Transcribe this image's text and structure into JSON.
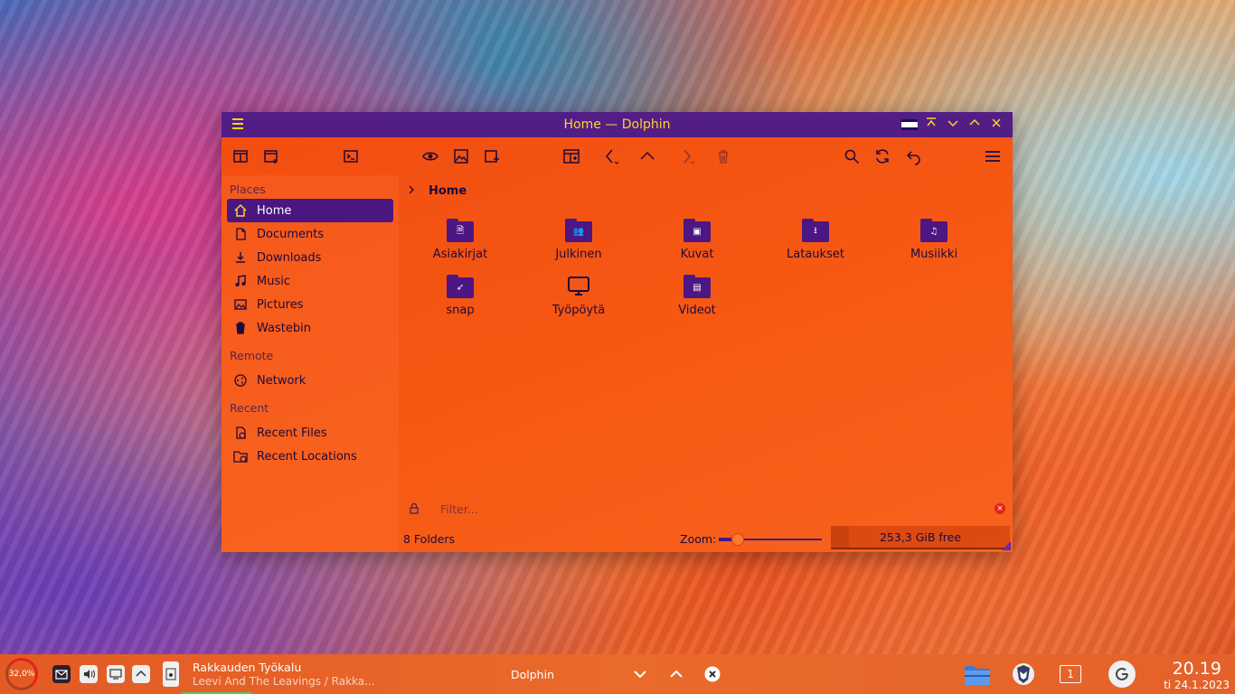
{
  "window": {
    "title": "Home — Dolphin"
  },
  "places": {
    "section_places": "Places",
    "section_remote": "Remote",
    "section_recent": "Recent",
    "items": [
      {
        "label": "Home",
        "icon": "home-icon"
      },
      {
        "label": "Documents",
        "icon": "documents-icon"
      },
      {
        "label": "Downloads",
        "icon": "downloads-icon"
      },
      {
        "label": "Music",
        "icon": "music-icon"
      },
      {
        "label": "Pictures",
        "icon": "pictures-icon"
      },
      {
        "label": "Wastebin",
        "icon": "trash-icon"
      }
    ],
    "remote": [
      {
        "label": "Network",
        "icon": "network-icon"
      }
    ],
    "recent": [
      {
        "label": "Recent Files",
        "icon": "recent-files-icon"
      },
      {
        "label": "Recent Locations",
        "icon": "recent-locations-icon"
      }
    ]
  },
  "breadcrumb": {
    "current": "Home"
  },
  "folders": [
    {
      "name": "Asiakirjat",
      "glyph": "🗎"
    },
    {
      "name": "Julkinen",
      "glyph": "👥"
    },
    {
      "name": "Kuvat",
      "glyph": "▣"
    },
    {
      "name": "Lataukset",
      "glyph": "⭳"
    },
    {
      "name": "Musiikki",
      "glyph": "♫"
    },
    {
      "name": "snap",
      "glyph": "➶"
    },
    {
      "name": "Työpöytä",
      "glyph": ""
    },
    {
      "name": "Videot",
      "glyph": "▤"
    }
  ],
  "filter": {
    "placeholder": "Filter..."
  },
  "status": {
    "summary": "8 Folders",
    "zoom_label": "Zoom:",
    "zoom_level": 0.18,
    "free_space": "253,3 GiB free",
    "disk_used_fraction": 0.1
  },
  "taskbar": {
    "cpu": "32,0%",
    "media_title": "Rakkauden Työkalu",
    "media_artist": "Leevi And The Leavings / Rakka...",
    "task_label": "Dolphin",
    "desktop_number": "1",
    "time": "20.19",
    "date": "ti 24.1.2023"
  },
  "colors": {
    "titlebar": "#531d86",
    "accent": "#4a1680",
    "title_text": "#ffd42a",
    "window_bg": "#f65a14"
  }
}
